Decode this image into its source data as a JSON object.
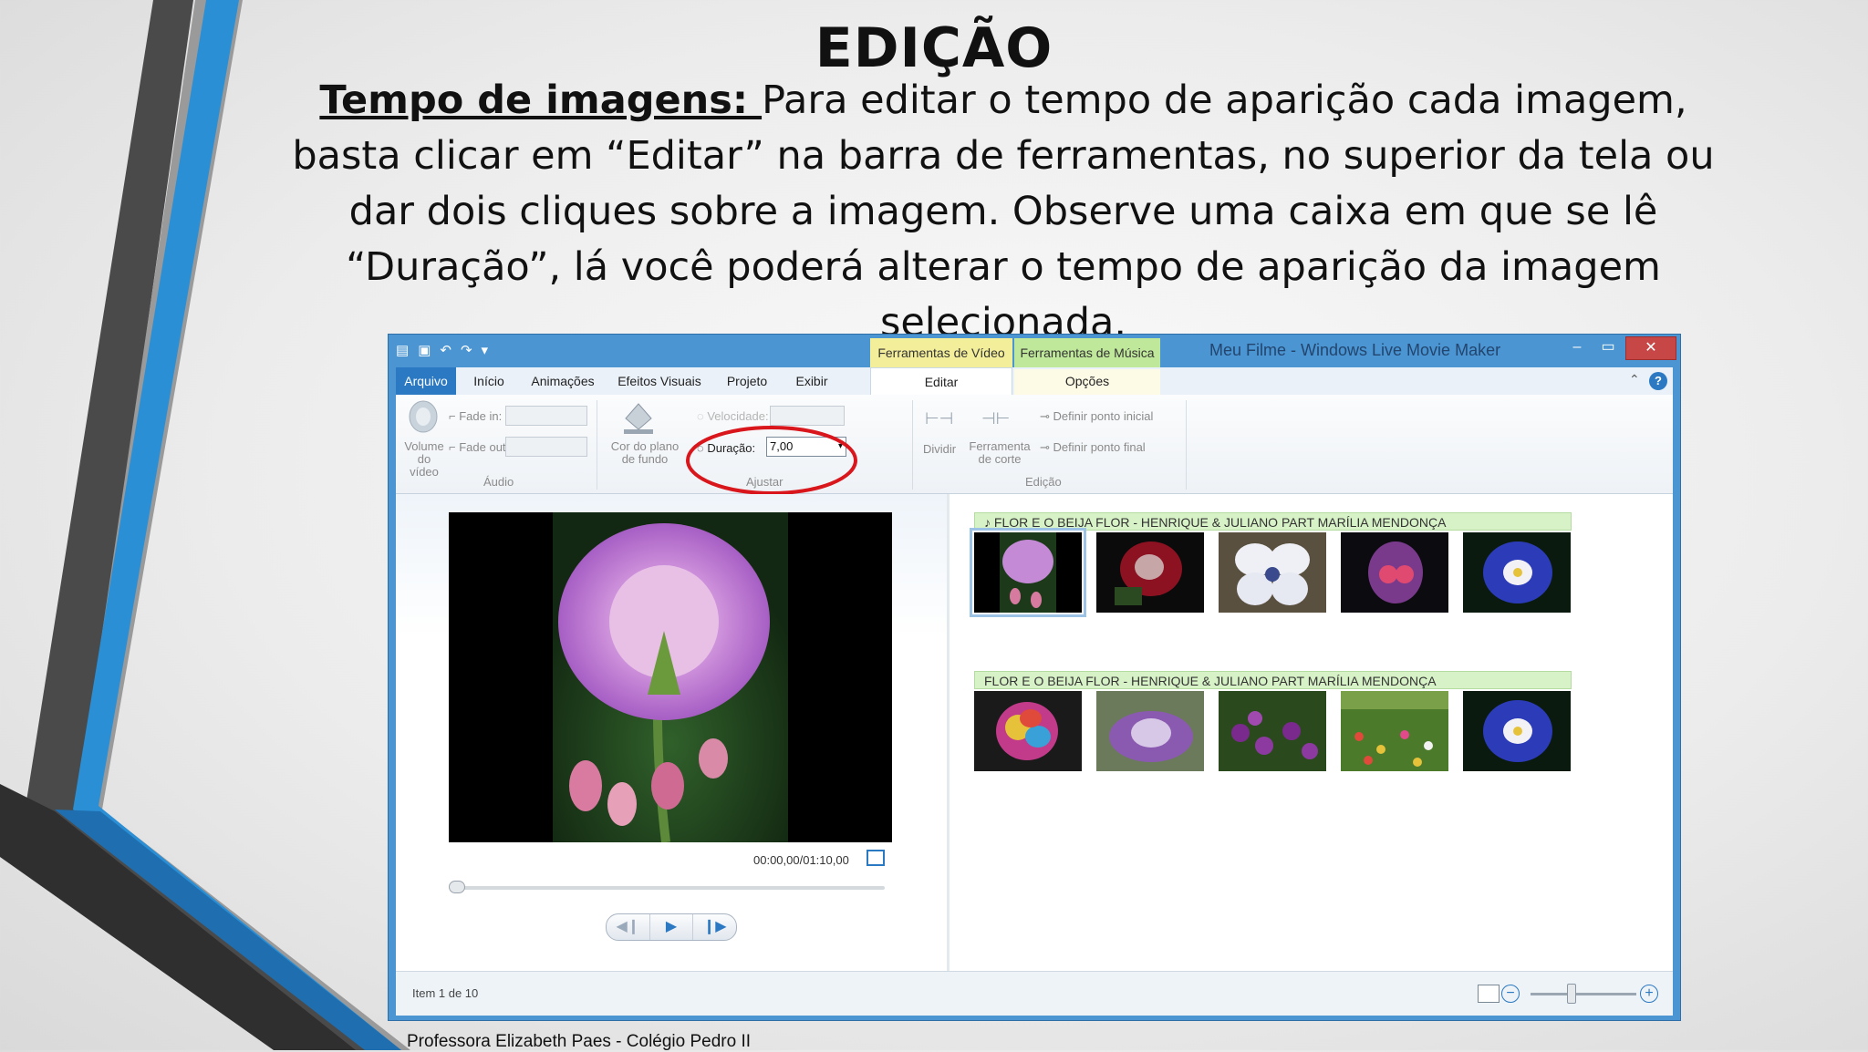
{
  "slide": {
    "title": "EDIÇÃO",
    "lead": "Tempo de imagens: ",
    "body": "Para editar o tempo de aparição cada imagem, basta clicar em “Editar” na barra de ferramentas, no superior da tela ou dar dois cliques sobre a imagem. Observe uma caixa em que se lê “Duração”, lá você poderá alterar o tempo de aparição da imagem selecionada.",
    "footer": "Professora Elizabeth Paes - Colégio Pedro II"
  },
  "window": {
    "title": "Meu Filme - Windows Live Movie Maker",
    "context_tabs": [
      "Ferramentas de Vídeo",
      "Ferramentas de Música"
    ],
    "close_glyph": "✕",
    "min_glyph": "–",
    "max_glyph": "▭"
  },
  "tabs": {
    "file": "Arquivo",
    "items": [
      "Início",
      "Animações",
      "Efeitos Visuais",
      "Projeto",
      "Exibir",
      "Editar",
      "Opções"
    ],
    "help": "?"
  },
  "ribbon": {
    "volume": "Volume do vídeo",
    "fade_in": "Fade in:",
    "fade_out": "Fade out:",
    "audio_group": "Áudio",
    "bg_color": "Cor do plano de fundo",
    "speed": "Velocidade:",
    "duration_label": "Duração:",
    "duration_value": "7,00",
    "adjust_group": "Ajustar",
    "split": "Dividir",
    "trim_tool": "Ferramenta de corte",
    "set_start": "Definir ponto inicial",
    "set_end": "Definir ponto final",
    "edit_group": "Edição"
  },
  "preview": {
    "timecode": "00:00,00/01:10,00"
  },
  "storyboard": {
    "music_track_1": "FLOR E O BEIJA FLOR - HENRIQUE & JULIANO PART MARÍLIA MENDONÇA",
    "music_track_2": "FLOR E O BEIJA FLOR - HENRIQUE & JULIANO PART MARÍLIA MENDONÇA",
    "music_note": "♪"
  },
  "status": {
    "item": "Item 1 de 10",
    "zoom_minus": "−",
    "zoom_plus": "+"
  },
  "colors": {
    "accent": "#2b79c2",
    "highlight_circle": "#d8161c"
  }
}
